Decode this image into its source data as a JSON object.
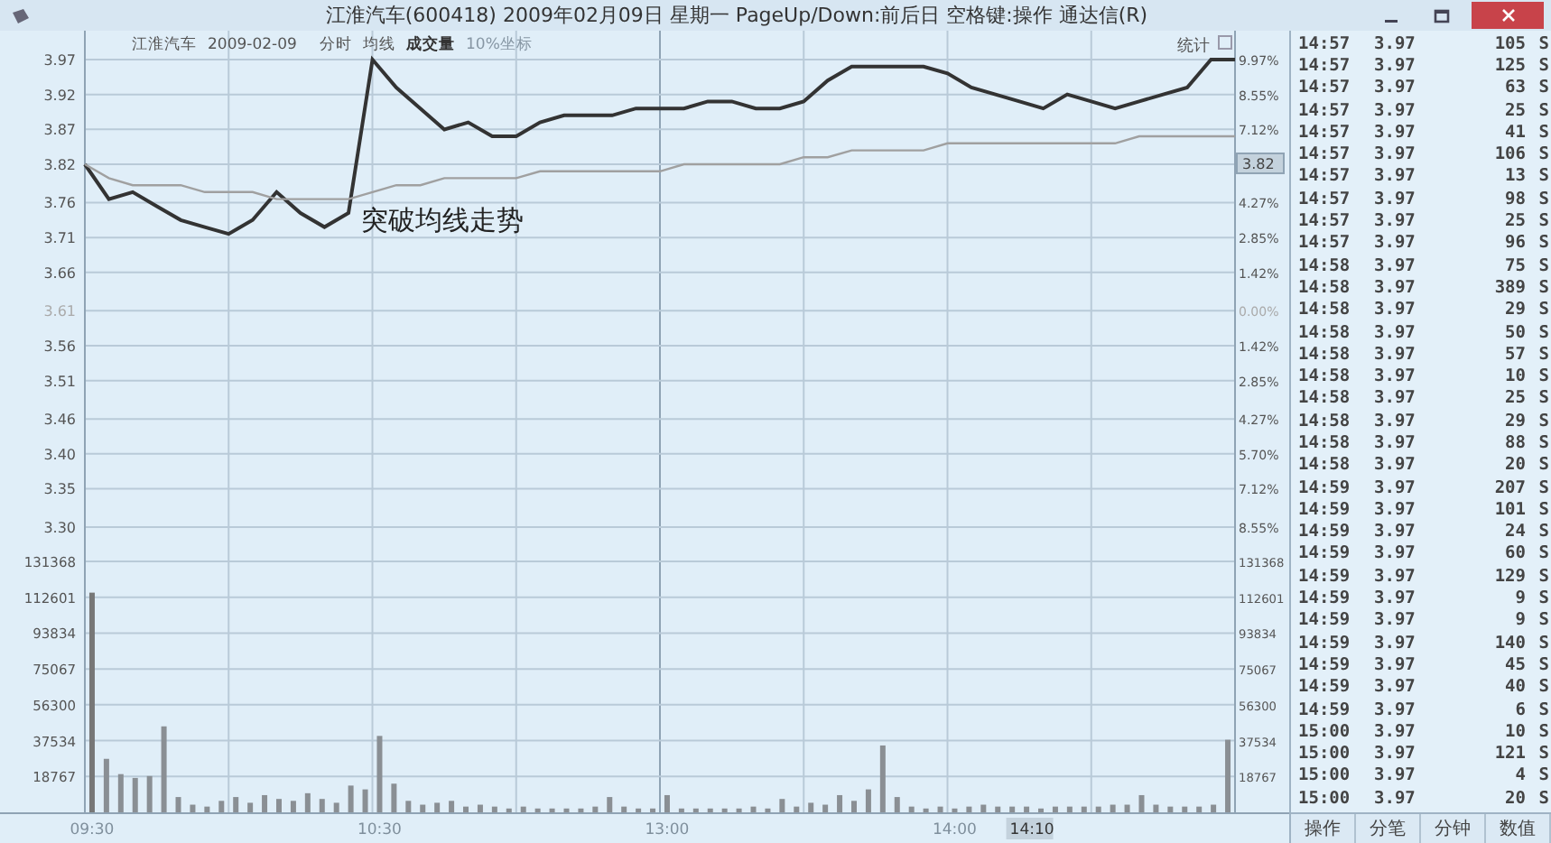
{
  "title_bar": {
    "title": "江淮汽车(600418) 2009年02月09日 星期一 PageUp/Down:前后日 空格键:操作 通达信(R)"
  },
  "chart_header": {
    "items": [
      {
        "text": "江淮汽车",
        "kind": "normal"
      },
      {
        "text": "2009-02-09",
        "kind": "normal"
      },
      {
        "text": "分时",
        "kind": "normal"
      },
      {
        "text": "均线",
        "kind": "normal"
      },
      {
        "text": "成交量",
        "kind": "bold"
      },
      {
        "text": "10%坐标",
        "kind": "faint"
      }
    ],
    "stats_label": "统计"
  },
  "price_chart": {
    "annotation": "突破均线走势",
    "right_labels": [
      {
        "label": "9.97%",
        "kind": "up"
      },
      {
        "label": "8.55%",
        "kind": "up"
      },
      {
        "label": "7.12%",
        "kind": "up"
      },
      {
        "label": "3.82",
        "kind": "tag"
      },
      {
        "label": "4.27%",
        "kind": "up"
      },
      {
        "label": "2.85%",
        "kind": "up"
      },
      {
        "label": "1.42%",
        "kind": "up"
      },
      {
        "label": "0.00%",
        "kind": "flat"
      },
      {
        "label": "1.42%",
        "kind": "down"
      },
      {
        "label": "2.85%",
        "kind": "down"
      },
      {
        "label": "4.27%",
        "kind": "down"
      },
      {
        "label": "5.70%",
        "kind": "down"
      },
      {
        "label": "7.12%",
        "kind": "down"
      },
      {
        "label": "8.55%",
        "kind": "down"
      }
    ],
    "chart_data": {
      "type": "line",
      "ylim": [
        3.3,
        3.97
      ],
      "grid": true,
      "categories": [
        null,
        null,
        null,
        null,
        null,
        null,
        null,
        null,
        null,
        null,
        null,
        null,
        null,
        null,
        null,
        null,
        null,
        null,
        null,
        null,
        null,
        null,
        null,
        null,
        null,
        null,
        null,
        null,
        null,
        null,
        null,
        null,
        null,
        null,
        null,
        null,
        null,
        null,
        null,
        null,
        null,
        null,
        null,
        null,
        null,
        null,
        null,
        null,
        null
      ],
      "series": [
        {
          "color": "#333333",
          "values": [
            3.82,
            3.77,
            3.78,
            3.76,
            3.74,
            3.73,
            3.72,
            3.74,
            3.78,
            3.75,
            3.73,
            3.75,
            3.97,
            3.93,
            3.9,
            3.87,
            3.88,
            3.86,
            3.86,
            3.88,
            3.89,
            3.89,
            3.89,
            3.9,
            3.9,
            3.9,
            3.91,
            3.91,
            3.9,
            3.9,
            3.91,
            3.94,
            3.96,
            3.96,
            3.96,
            3.96,
            3.95,
            3.93,
            3.92,
            3.91,
            3.9,
            3.92,
            3.91,
            3.9,
            3.91,
            3.92,
            3.93,
            3.97,
            3.97
          ]
        },
        {
          "color": "#a0a0a0",
          "values": [
            3.82,
            3.8,
            3.79,
            3.79,
            3.79,
            3.78,
            3.78,
            3.78,
            3.77,
            3.77,
            3.77,
            3.77,
            3.78,
            3.79,
            3.79,
            3.8,
            3.8,
            3.8,
            3.8,
            3.81,
            3.81,
            3.81,
            3.81,
            3.81,
            3.81,
            3.82,
            3.82,
            3.82,
            3.82,
            3.82,
            3.83,
            3.83,
            3.84,
            3.84,
            3.84,
            3.84,
            3.85,
            3.85,
            3.85,
            3.85,
            3.85,
            3.85,
            3.85,
            3.85,
            3.86,
            3.86,
            3.86,
            3.86,
            3.86
          ]
        }
      ],
      "yticks": [
        {
          "value": 3.97,
          "label": "3.97"
        },
        {
          "value": 3.92,
          "label": "3.92"
        },
        {
          "value": 3.87,
          "label": "3.87"
        },
        {
          "value": 3.82,
          "label": "3.82"
        },
        {
          "value": 3.765,
          "label": "3.76"
        },
        {
          "value": 3.715,
          "label": "3.71"
        },
        {
          "value": 3.665,
          "label": "3.66"
        },
        {
          "value": 3.61,
          "label": "3.61"
        },
        {
          "value": 3.56,
          "label": "3.56"
        },
        {
          "value": 3.51,
          "label": "3.51"
        },
        {
          "value": 3.455,
          "label": "3.46"
        },
        {
          "value": 3.405,
          "label": "3.40"
        },
        {
          "value": 3.355,
          "label": "3.35"
        },
        {
          "value": 3.3,
          "label": "3.30"
        }
      ]
    }
  },
  "volume_chart": {
    "right_labels": [
      "131368",
      "112601",
      "93834",
      "75067",
      "56300",
      "37534",
      "18767"
    ],
    "time_tag": "14:10",
    "chart_data": {
      "type": "bar",
      "ylim": [
        0,
        131368
      ],
      "grid": true,
      "categories": [
        "09:30",
        null,
        null,
        null,
        null,
        null,
        null,
        null,
        null,
        null,
        null,
        null,
        null,
        null,
        null,
        null,
        null,
        null,
        null,
        null,
        "10:30",
        null,
        null,
        null,
        null,
        null,
        null,
        null,
        null,
        null,
        null,
        null,
        null,
        null,
        null,
        null,
        null,
        null,
        null,
        null,
        "13:00",
        null,
        null,
        null,
        null,
        null,
        null,
        null,
        null,
        null,
        null,
        null,
        null,
        null,
        null,
        null,
        null,
        null,
        null,
        null,
        "14:00",
        null,
        null,
        null,
        null,
        null,
        null,
        null,
        null,
        null,
        null,
        null,
        null,
        null,
        null,
        null,
        null,
        null,
        null,
        null
      ],
      "values": [
        115000,
        28000,
        20000,
        18000,
        19000,
        45000,
        8000,
        4000,
        3000,
        6000,
        8000,
        5000,
        9000,
        7000,
        6000,
        10000,
        7000,
        5000,
        14000,
        12000,
        40000,
        15000,
        6000,
        4000,
        5000,
        6000,
        3000,
        4000,
        3000,
        2000,
        3000,
        2000,
        2000,
        2000,
        2000,
        3000,
        8000,
        3000,
        2000,
        2000,
        9000,
        2000,
        2000,
        2000,
        2000,
        2000,
        3000,
        2000,
        7000,
        3000,
        5000,
        4000,
        9000,
        6000,
        12000,
        35000,
        8000,
        3000,
        2000,
        3000,
        2000,
        3000,
        4000,
        3000,
        3000,
        3000,
        2000,
        3000,
        3000,
        3000,
        3000,
        4000,
        4000,
        9000,
        4000,
        3000,
        3000,
        3000,
        4000,
        38000
      ],
      "yticks": [
        {
          "value": 131368,
          "label": "131368"
        },
        {
          "value": 112601,
          "label": "112601"
        },
        {
          "value": 93834,
          "label": "93834"
        },
        {
          "value": 75067,
          "label": "75067"
        },
        {
          "value": 56300,
          "label": "56300"
        },
        {
          "value": 37534,
          "label": "37534"
        },
        {
          "value": 18767,
          "label": "18767"
        }
      ]
    }
  },
  "trades": {
    "rows": [
      {
        "time": "14:57",
        "price": "3.97",
        "volume": "105",
        "side": "S"
      },
      {
        "time": "14:57",
        "price": "3.97",
        "volume": "125",
        "side": "S"
      },
      {
        "time": "14:57",
        "price": "3.97",
        "volume": "63",
        "side": "S"
      },
      {
        "time": "14:57",
        "price": "3.97",
        "volume": "25",
        "side": "S"
      },
      {
        "time": "14:57",
        "price": "3.97",
        "volume": "41",
        "side": "S"
      },
      {
        "time": "14:57",
        "price": "3.97",
        "volume": "106",
        "side": "S"
      },
      {
        "time": "14:57",
        "price": "3.97",
        "volume": "13",
        "side": "S"
      },
      {
        "time": "14:57",
        "price": "3.97",
        "volume": "98",
        "side": "S"
      },
      {
        "time": "14:57",
        "price": "3.97",
        "volume": "25",
        "side": "S"
      },
      {
        "time": "14:57",
        "price": "3.97",
        "volume": "96",
        "side": "S"
      },
      {
        "time": "14:58",
        "price": "3.97",
        "volume": "75",
        "side": "S"
      },
      {
        "time": "14:58",
        "price": "3.97",
        "volume": "389",
        "side": "S"
      },
      {
        "time": "14:58",
        "price": "3.97",
        "volume": "29",
        "side": "S"
      },
      {
        "time": "14:58",
        "price": "3.97",
        "volume": "50",
        "side": "S"
      },
      {
        "time": "14:58",
        "price": "3.97",
        "volume": "57",
        "side": "S"
      },
      {
        "time": "14:58",
        "price": "3.97",
        "volume": "10",
        "side": "S"
      },
      {
        "time": "14:58",
        "price": "3.97",
        "volume": "25",
        "side": "S"
      },
      {
        "time": "14:58",
        "price": "3.97",
        "volume": "29",
        "side": "S"
      },
      {
        "time": "14:58",
        "price": "3.97",
        "volume": "88",
        "side": "S"
      },
      {
        "time": "14:58",
        "price": "3.97",
        "volume": "20",
        "side": "S"
      },
      {
        "time": "14:59",
        "price": "3.97",
        "volume": "207",
        "side": "S"
      },
      {
        "time": "14:59",
        "price": "3.97",
        "volume": "101",
        "side": "S"
      },
      {
        "time": "14:59",
        "price": "3.97",
        "volume": "24",
        "side": "S"
      },
      {
        "time": "14:59",
        "price": "3.97",
        "volume": "60",
        "side": "S"
      },
      {
        "time": "14:59",
        "price": "3.97",
        "volume": "129",
        "side": "S"
      },
      {
        "time": "14:59",
        "price": "3.97",
        "volume": "9",
        "side": "S"
      },
      {
        "time": "14:59",
        "price": "3.97",
        "volume": "9",
        "side": "S"
      },
      {
        "time": "14:59",
        "price": "3.97",
        "volume": "140",
        "side": "S"
      },
      {
        "time": "14:59",
        "price": "3.97",
        "volume": "45",
        "side": "S"
      },
      {
        "time": "14:59",
        "price": "3.97",
        "volume": "40",
        "side": "S"
      },
      {
        "time": "14:59",
        "price": "3.97",
        "volume": "6",
        "side": "S"
      },
      {
        "time": "15:00",
        "price": "3.97",
        "volume": "10",
        "side": "S"
      },
      {
        "time": "15:00",
        "price": "3.97",
        "volume": "121",
        "side": "S"
      },
      {
        "time": "15:00",
        "price": "3.97",
        "volume": "4",
        "side": "S"
      },
      {
        "time": "15:00",
        "price": "3.97",
        "volume": "20",
        "side": "S"
      }
    ]
  },
  "bottom_tabs": [
    {
      "label": "操作"
    },
    {
      "label": "分笔"
    },
    {
      "label": "分钟"
    },
    {
      "label": "数值"
    }
  ]
}
